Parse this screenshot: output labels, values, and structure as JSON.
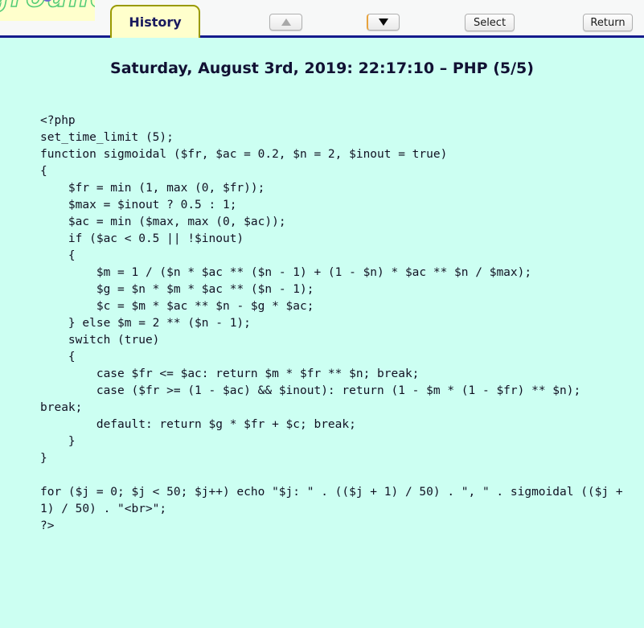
{
  "logo": {
    "text": "ground",
    "dot_icon": "circle-dot-icon",
    "stroke_color": "#55cc77",
    "background": "#ffffcc",
    "dot_color": "#6a6ad0"
  },
  "toolbar": {
    "tab_label": "History",
    "scroll_up_label": "▲",
    "scroll_down_label": "▼",
    "select_label": "Select",
    "return_label": "Return",
    "up_enabled": "false",
    "down_enabled": "true",
    "background": "#f7f8f8",
    "rule_color": "#151b8d"
  },
  "main": {
    "title": "Saturday, August 3rd, 2019: 22:17:10 – PHP (5/5)",
    "background": "#ccfff2",
    "code": "<?php\nset_time_limit (5);\nfunction sigmoidal ($fr, $ac = 0.2, $n = 2, $inout = true)\n{\n    $fr = min (1, max (0, $fr));\n    $max = $inout ? 0.5 : 1;\n    $ac = min ($max, max (0, $ac));\n    if ($ac < 0.5 || !$inout)\n    {\n        $m = 1 / ($n * $ac ** ($n - 1) + (1 - $n) * $ac ** $n / $max);\n        $g = $n * $m * $ac ** ($n - 1);\n        $c = $m * $ac ** $n - $g * $ac;\n    } else $m = 2 ** ($n - 1);\n    switch (true)\n    {\n        case $fr <= $ac: return $m * $fr ** $n; break;\n        case ($fr >= (1 - $ac) && $inout): return (1 - $m * (1 - $fr) ** $n); break;\n        default: return $g * $fr + $c; break;\n    }\n}\n\nfor ($j = 0; $j < 50; $j++) echo \"$j: \" . (($j + 1) / 50) . \", \" . sigmoidal (($j + 1) / 50) . \"<br>\";\n?>"
  }
}
